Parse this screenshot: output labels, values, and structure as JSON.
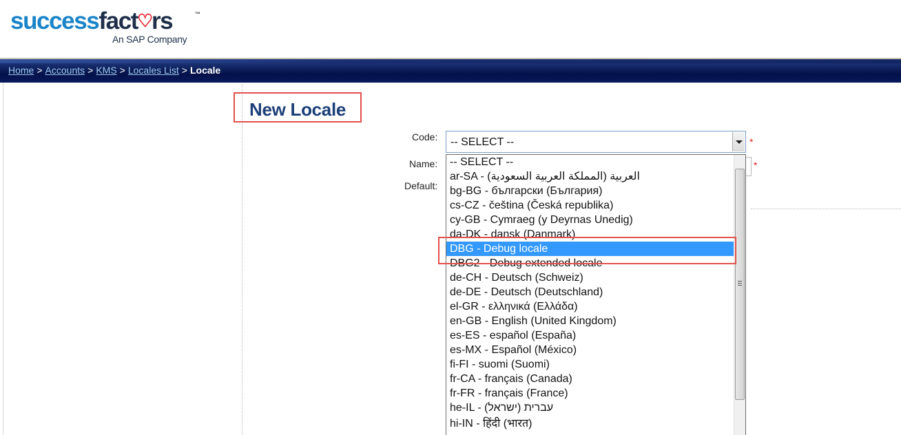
{
  "logo": {
    "brand_part1": "success",
    "brand_part2": "factors",
    "tagline": "An SAP Company",
    "trademark": "™"
  },
  "breadcrumb": {
    "items": [
      "Home",
      "Accounts",
      "KMS",
      "Locales List"
    ],
    "separator": ">",
    "current": "Locale"
  },
  "page": {
    "title": "New Locale"
  },
  "form": {
    "code_label": "Code:",
    "name_label": "Name:",
    "default_label": "Default:",
    "required_marker": "*",
    "code_selected_value": "-- SELECT --"
  },
  "dropdown": {
    "options": [
      "-- SELECT --",
      "ar-SA - العربية (المملكة العربية السعودية)",
      "bg-BG - български (България)",
      "cs-CZ - čeština (Česká republika)",
      "cy-GB - Cymraeg (y Deyrnas Unedig)",
      "da-DK - dansk (Danmark)",
      "DBG - Debug locale",
      "DBG2 - Debug extended locale",
      "de-CH - Deutsch (Schweiz)",
      "de-DE - Deutsch (Deutschland)",
      "el-GR - ελληνικά (Ελλάδα)",
      "en-GB - English (United Kingdom)",
      "es-ES - español (España)",
      "es-MX - Español (México)",
      "fi-FI - suomi (Suomi)",
      "fr-CA - français (Canada)",
      "fr-FR - français (France)",
      "he-IL - עברית (ישראל)",
      "hi-IN - हिंदी (भारत)"
    ],
    "highlighted_option": "DBG - Debug locale"
  },
  "colors": {
    "title": "#1c3f78",
    "link": "#9cc8f0",
    "highlight_box": "#e2504c",
    "selection": "#3399ff",
    "required": "#e02020"
  }
}
